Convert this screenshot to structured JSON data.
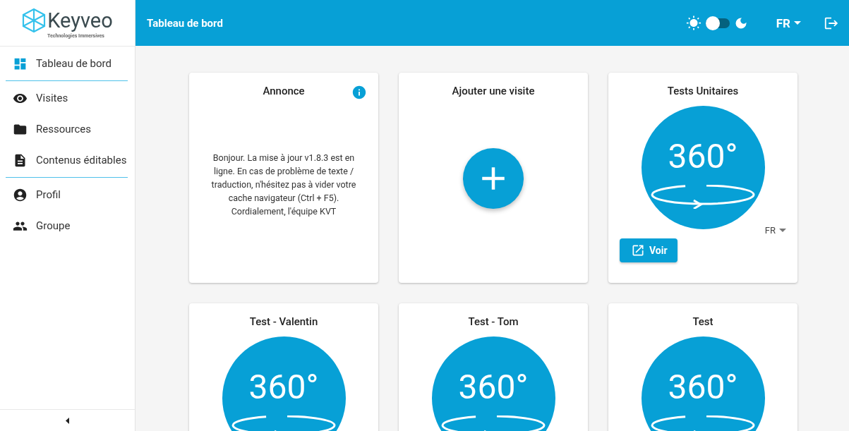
{
  "logo": {
    "name": "Keyveo",
    "tagline": "Technologies Immersives"
  },
  "header": {
    "title": "Tableau de bord",
    "dark_mode": {
      "on": false
    },
    "language": "FR"
  },
  "sidebar": {
    "groups": [
      [
        {
          "label": "Tableau de bord",
          "kind": "dashboard",
          "selected": true
        }
      ],
      [
        {
          "label": "Visites",
          "kind": "eye",
          "selected": false
        },
        {
          "label": "Ressources",
          "kind": "folder",
          "selected": false
        },
        {
          "label": "Contenus éditables",
          "kind": "document",
          "selected": false
        }
      ],
      [
        {
          "label": "Profil",
          "kind": "profile",
          "selected": false
        },
        {
          "label": "Groupe",
          "kind": "group",
          "selected": false
        }
      ]
    ]
  },
  "cards": [
    {
      "kind": "announcement",
      "title": "Annonce",
      "text": "Bonjour. La mise à jour v1.8.3 est en ligne. En cas de problème de texte / traduction, n'hésitez pas à vider votre cache navigateur (Ctrl + F5). Cordialement, l'équipe KVT"
    },
    {
      "kind": "add",
      "title": "Ajouter une visite"
    },
    {
      "kind": "visit",
      "title": "Tests Unitaires",
      "logo_text": "360°",
      "language": "FR",
      "button": "Voir"
    },
    {
      "kind": "visit",
      "title": "Test - Valentin",
      "logo_text": "360°"
    },
    {
      "kind": "visit",
      "title": "Test - Tom",
      "logo_text": "360°"
    },
    {
      "kind": "visit",
      "title": "Test",
      "logo_text": "360°"
    }
  ]
}
